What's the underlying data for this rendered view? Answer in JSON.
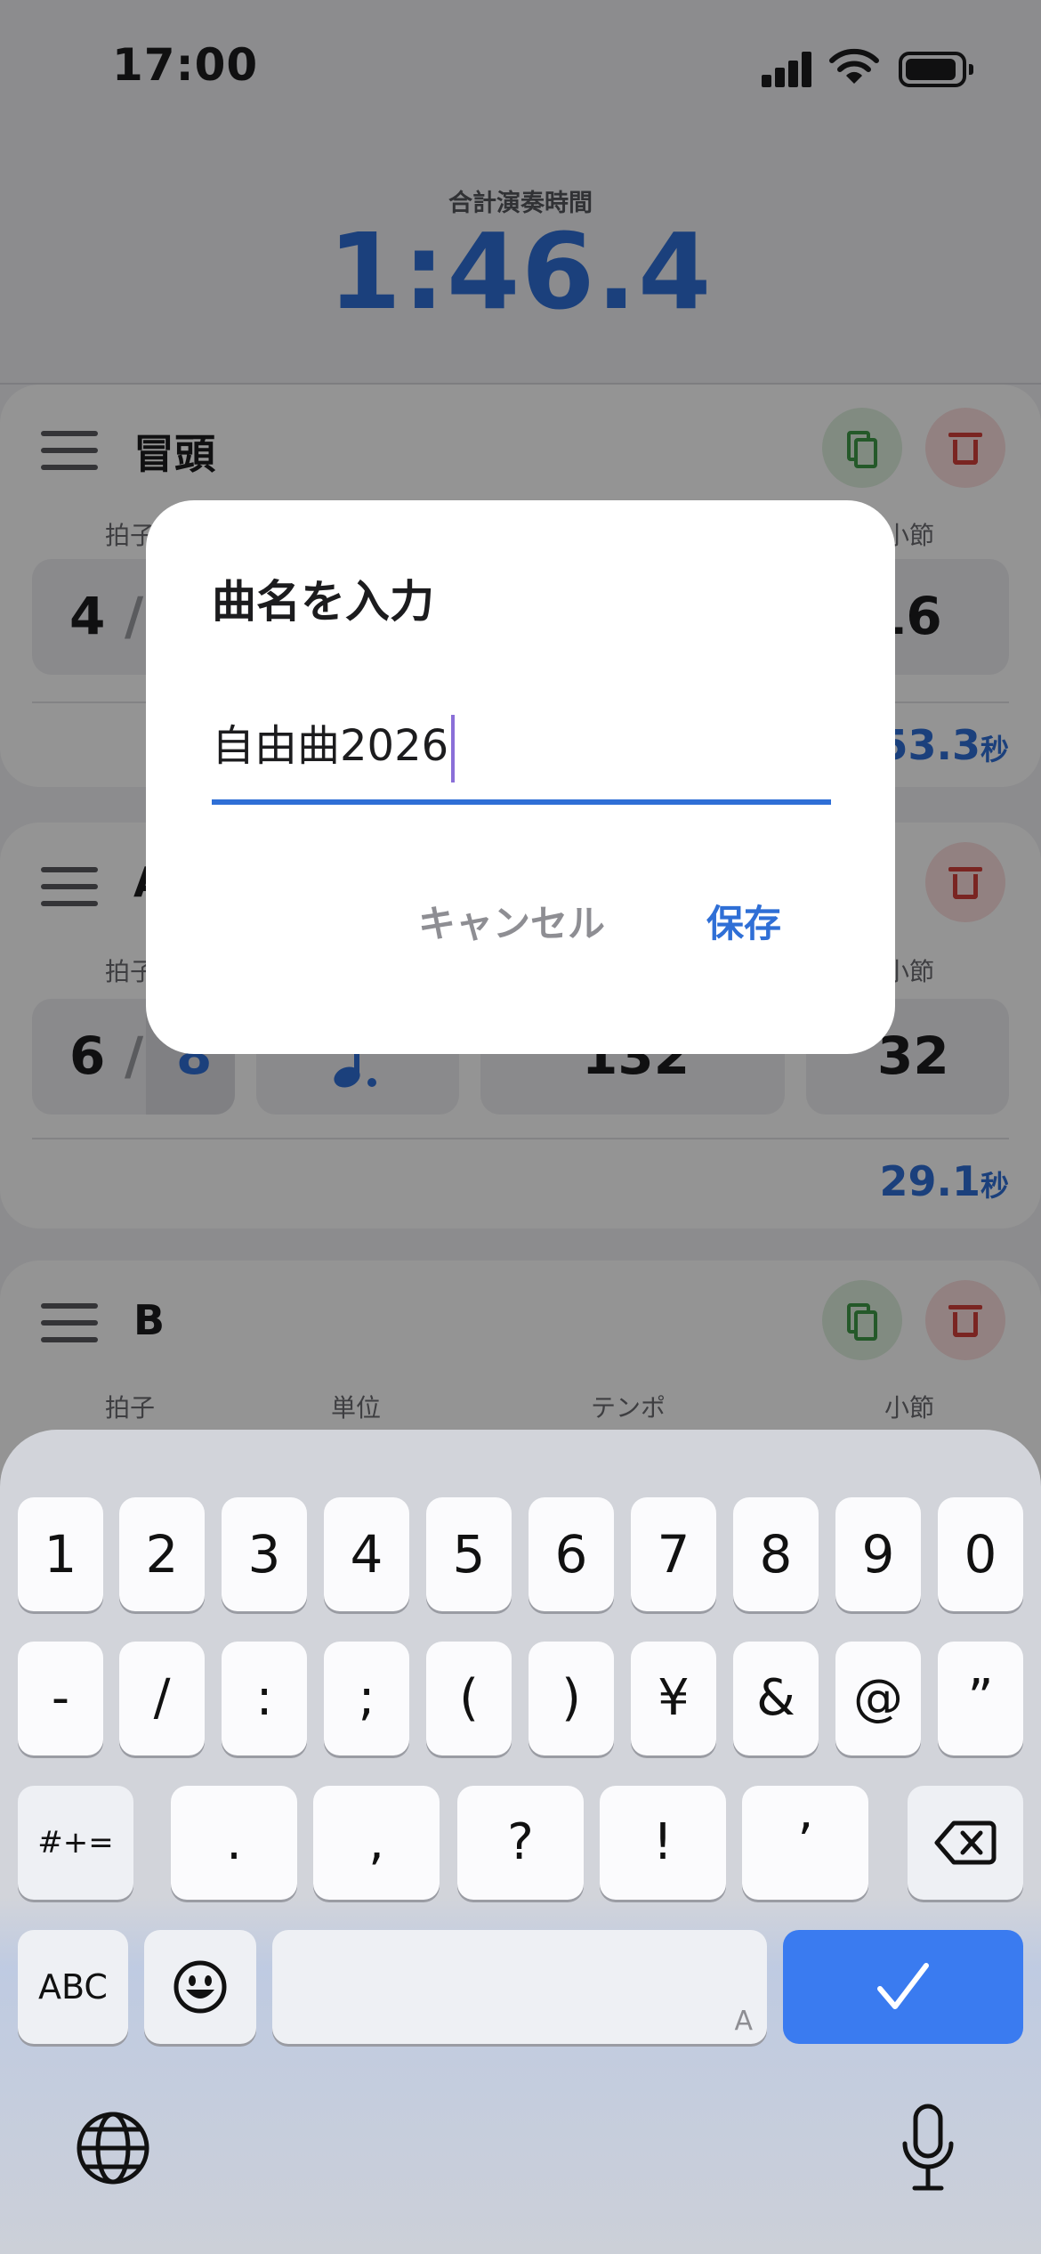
{
  "status": {
    "time": "17:00"
  },
  "header": {
    "total_label": "合計演奏時間",
    "total_time": "1:46.4"
  },
  "sections": [
    {
      "name": "冒頭",
      "beat_num": "4",
      "beat_slash": "/",
      "bars_value": "16",
      "duration_value": "53.3",
      "duration_unit": "秒",
      "bars_label": "小節",
      "beat_label": "拍子"
    },
    {
      "name": "A",
      "beat_num": "6",
      "beat_slash": "/",
      "beat_den": "8",
      "tempo_value": "132",
      "bars_value": "32",
      "duration_value": "29.1",
      "duration_unit": "秒",
      "bars_label": "小節",
      "beat_label": "拍子"
    },
    {
      "name": "B",
      "beat_label": "拍子",
      "unit_label": "単位",
      "tempo_label": "テンポ",
      "bars_label": "小節"
    }
  ],
  "dialog": {
    "title": "曲名を入力",
    "input_value": "自由曲2026",
    "cancel_label": "キャンセル",
    "save_label": "保存",
    "accent_color": "#2f6fd6"
  },
  "keyboard": {
    "row1": [
      "1",
      "2",
      "3",
      "4",
      "5",
      "6",
      "7",
      "8",
      "9",
      "0"
    ],
    "row2": [
      "-",
      "/",
      ":",
      ";",
      "(",
      ")",
      "¥",
      "&",
      "@",
      "”"
    ],
    "row3": [
      ".",
      ",",
      "?",
      "!",
      "’"
    ],
    "shift_label": "#+=",
    "abc_label": "ABC",
    "space_hint": "A",
    "delete_icon": "backspace-icon",
    "emoji_icon": "emoji-icon",
    "globe_icon": "globe-icon",
    "mic_icon": "microphone-icon",
    "done_icon": "checkmark-icon"
  }
}
